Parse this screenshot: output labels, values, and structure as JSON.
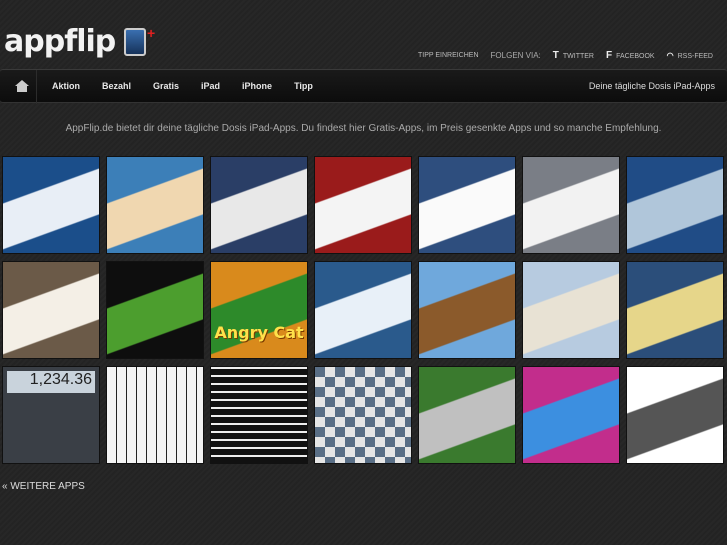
{
  "header": {
    "logo": "appflip",
    "links": {
      "tip": "TIPP EINREICHEN",
      "follow": "FOLGEN VIA:",
      "twitter": "TWITTER",
      "facebook": "FACEBOOK",
      "rss": "RSS-FEED"
    }
  },
  "nav": {
    "items": [
      "Aktion",
      "Bezahl",
      "Gratis",
      "iPad",
      "iPhone",
      "Tipp"
    ],
    "tagline": "Deine tägliche Dosis iPad-Apps"
  },
  "intro": "AppFlip.de bietet dir deine tägliche Dosis iPad-Apps. Du findest hier Gratis-Apps, im Preis gesenkte Apps und so manche Empfehlung.",
  "tiles": [
    {
      "name": "app-tile-news-1",
      "colors": [
        "#1b4e8a",
        "#e8eef6"
      ]
    },
    {
      "name": "app-tile-cartoon",
      "colors": [
        "#3c7fb8",
        "#f0d7b0"
      ]
    },
    {
      "name": "app-tile-news-2",
      "colors": [
        "#2a3e66",
        "#e8e8e8"
      ]
    },
    {
      "name": "app-tile-tv",
      "colors": [
        "#9a1b1b",
        "#f4f4f4"
      ]
    },
    {
      "name": "app-tile-web",
      "colors": [
        "#2e4e7e",
        "#fafafa"
      ]
    },
    {
      "name": "app-tile-settings",
      "colors": [
        "#7a7e86",
        "#f2f2f2"
      ]
    },
    {
      "name": "app-tile-racing",
      "colors": [
        "#204c86",
        "#b0c6da"
      ]
    },
    {
      "name": "app-tile-notes",
      "colors": [
        "#6b5a48",
        "#f4efe6"
      ]
    },
    {
      "name": "app-tile-match-game",
      "colors": [
        "#0e0e0e",
        "#4c9e2e"
      ]
    },
    {
      "name": "app-tile-angry-cat",
      "colors": [
        "#d98a1c",
        "#2d8a2a"
      ]
    },
    {
      "name": "app-tile-browser",
      "colors": [
        "#2a5a8c",
        "#e8f0f8"
      ]
    },
    {
      "name": "app-tile-platformer",
      "colors": [
        "#6fa8dc",
        "#8b5a2b"
      ]
    },
    {
      "name": "app-tile-map",
      "colors": [
        "#b7cbe0",
        "#e8e2d4"
      ]
    },
    {
      "name": "app-tile-atlas",
      "colors": [
        "#2b4e7a",
        "#e6d68a"
      ]
    },
    {
      "name": "app-tile-calculator",
      "colors": [
        "#3a3f46",
        "#c9d3dc"
      ]
    },
    {
      "name": "app-tile-piano",
      "colors": [
        "#f0f0f0",
        "#111111"
      ]
    },
    {
      "name": "app-tile-maze",
      "colors": [
        "#111111",
        "#eeeeee"
      ]
    },
    {
      "name": "app-tile-chess",
      "colors": [
        "#5a6f86",
        "#d8d8d8"
      ]
    },
    {
      "name": "app-tile-basketball",
      "colors": [
        "#3a7a2e",
        "#c0c0c0"
      ]
    },
    {
      "name": "app-tile-bubbles",
      "colors": [
        "#c22d8c",
        "#3c8fe0"
      ]
    },
    {
      "name": "app-tile-text-doc",
      "colors": [
        "#ffffff",
        "#555555"
      ]
    }
  ],
  "calculator_value": "1,234.36",
  "angry_cat_title": "Angry Cat",
  "more_link": "« WEITERE APPS"
}
